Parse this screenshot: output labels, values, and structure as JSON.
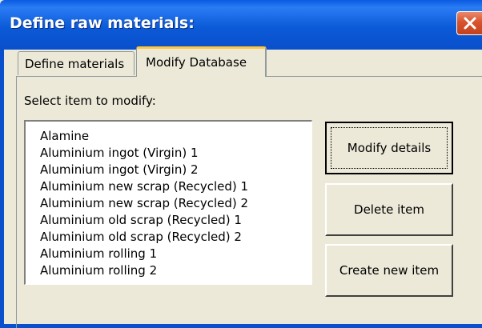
{
  "window": {
    "title": "Define raw materials:"
  },
  "tabs": [
    {
      "label": "Define materials",
      "active": false
    },
    {
      "label": "Modify Database",
      "active": true
    }
  ],
  "panel": {
    "select_label": "Select item to modify:",
    "list_items": [
      "Alamine",
      "Aluminium ingot (Virgin) 1",
      "Aluminium ingot (Virgin) 2",
      "Aluminium new scrap (Recycled) 1",
      "Aluminium new scrap (Recycled) 2",
      "Aluminium old scrap (Recycled) 1",
      "Aluminium old scrap (Recycled) 2",
      "Aluminium rolling 1",
      "Aluminium rolling 2"
    ],
    "buttons": {
      "modify": "Modify details",
      "delete": "Delete item",
      "create": "Create new item"
    }
  },
  "colors": {
    "titlebar": "#0a5ae0",
    "close": "#d8522d",
    "active_tab_accent": "#ffc83c",
    "face": "#ece9d8"
  }
}
